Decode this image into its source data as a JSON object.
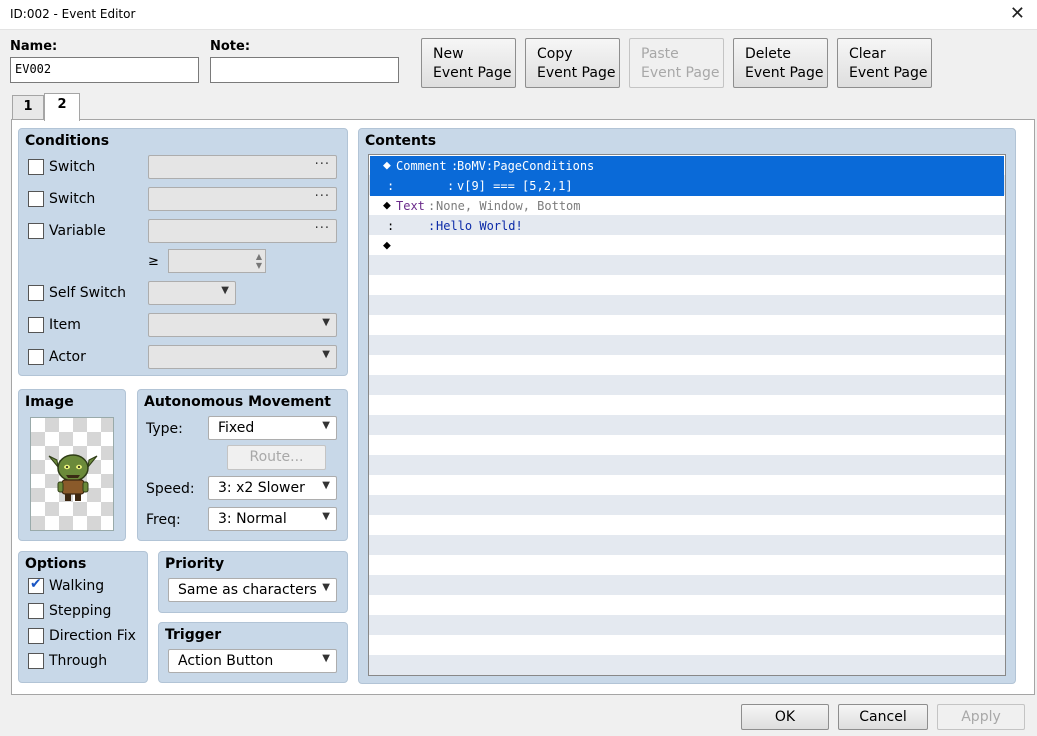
{
  "window": {
    "title": "ID:002 - Event Editor",
    "close": "✕"
  },
  "name_field": {
    "label": "Name:",
    "value": "EV002"
  },
  "note_field": {
    "label": "Note:",
    "value": ""
  },
  "page_buttons": {
    "new": [
      "New",
      "Event Page"
    ],
    "copy": [
      "Copy",
      "Event Page"
    ],
    "paste": [
      "Paste",
      "Event Page"
    ],
    "delete": [
      "Delete",
      "Event Page"
    ],
    "clear": [
      "Clear",
      "Event Page"
    ]
  },
  "tabs": [
    "1",
    "2"
  ],
  "conditions": {
    "title": "Conditions",
    "switch1": "Switch",
    "switch2": "Switch",
    "variable": "Variable",
    "ge": "≥",
    "self_switch": "Self Switch",
    "item": "Item",
    "actor": "Actor",
    "dots": "···"
  },
  "image": {
    "title": "Image"
  },
  "autonomous": {
    "title": "Autonomous Movement",
    "type_label": "Type:",
    "type_value": "Fixed",
    "route": "Route...",
    "speed_label": "Speed:",
    "speed_value": "3: x2 Slower",
    "freq_label": "Freq:",
    "freq_value": "3: Normal"
  },
  "options": {
    "title": "Options",
    "walking": "Walking",
    "stepping": "Stepping",
    "direction_fix": "Direction Fix",
    "through": "Through"
  },
  "priority": {
    "title": "Priority",
    "value": "Same as characters"
  },
  "trigger": {
    "title": "Trigger",
    "value": "Action Button"
  },
  "contents": {
    "title": "Contents",
    "rows": [
      {
        "cmd": "Comment",
        "text": "BoMV:PageConditions"
      },
      {
        "cmd": "",
        "text": "v[9] === [5,2,1]"
      },
      {
        "cmd": "Text",
        "text": "None, Window, Bottom"
      },
      {
        "cmd": "",
        "text": "Hello World!"
      }
    ],
    "diamond": "◆",
    "colon": ":"
  },
  "footer": {
    "ok": "OK",
    "cancel": "Cancel",
    "apply": "Apply"
  },
  "colors": {
    "selection": "#0a6ad8",
    "panel": "#c8d8e8",
    "comment_cmd": "#6a2a8a"
  }
}
